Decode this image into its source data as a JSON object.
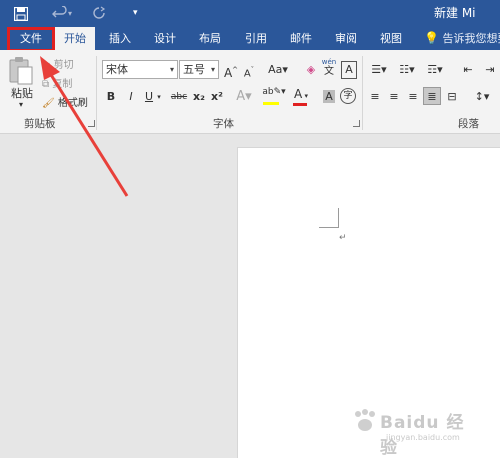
{
  "title_bar": {
    "doc_title": "新建 Mi",
    "save_icon": "save-icon",
    "undo_icon": "undo-icon",
    "redo_icon": "redo-icon",
    "customize_icon": "customize-qat-icon"
  },
  "tabs": [
    {
      "label": "文件"
    },
    {
      "label": "开始"
    },
    {
      "label": "插入"
    },
    {
      "label": "设计"
    },
    {
      "label": "布局"
    },
    {
      "label": "引用"
    },
    {
      "label": "邮件"
    },
    {
      "label": "审阅"
    },
    {
      "label": "视图"
    }
  ],
  "tell_me": {
    "text": "告诉我您想要"
  },
  "clipboard": {
    "paste": "粘贴",
    "cut": "剪切",
    "copy": "复制",
    "format_painter": "格式刷",
    "group_label": "剪贴板"
  },
  "font": {
    "font_name": "宋体",
    "font_size": "五号",
    "phonetic_top": "wén",
    "phonetic_bottom": "文",
    "group_label": "字体",
    "buttons": [
      "B",
      "I",
      "U",
      "abc",
      "x₂",
      "x²"
    ]
  },
  "paragraph": {
    "group_label": "段落"
  },
  "watermark": {
    "main": "Baidu 经验",
    "sub": "jingyan.baidu.com"
  },
  "colors": {
    "accent": "#2b579a",
    "ribbon": "#f3f3f3",
    "highlight_box": "#e02020",
    "arrow": "#e8403a",
    "font_color_bar": "#e02020",
    "highlight_bar": "#ffff00"
  }
}
